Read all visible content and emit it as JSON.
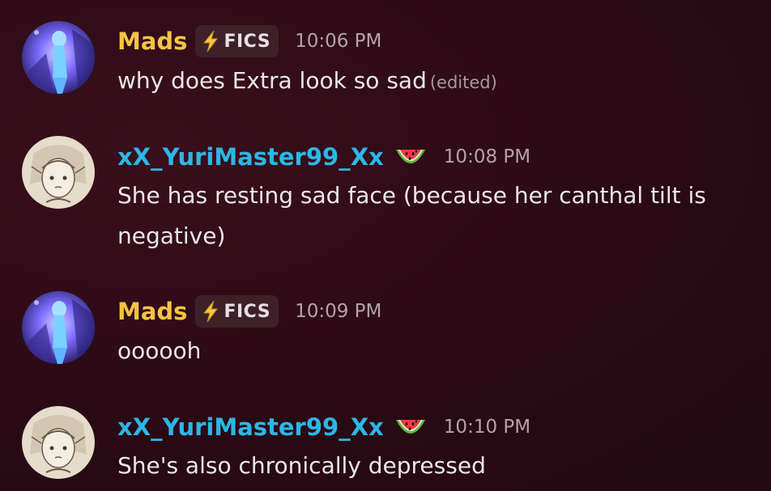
{
  "messages": [
    {
      "username": "Mads",
      "tag": "FICS",
      "tag_icon": "lightning-bolt-icon",
      "time": "10:06 PM",
      "text": "why does Extra look so sad",
      "edited": "(edited)"
    },
    {
      "username": "xX_YuriMaster99_Xx",
      "emoji": "watermelon-icon",
      "time": "10:08 PM",
      "text": "She has resting sad face (because her canthal tilt is negative)"
    },
    {
      "username": "Mads",
      "tag": "FICS",
      "tag_icon": "lightning-bolt-icon",
      "time": "10:09 PM",
      "text": "oooooh"
    },
    {
      "username": "xX_YuriMaster99_Xx",
      "emoji": "watermelon-icon",
      "time": "10:10 PM",
      "text": "She's also chronically depressed"
    }
  ],
  "colors": {
    "background": "#2a0c14",
    "mads_name": "#f4c542",
    "yuri_name": "#2cb7e6",
    "timestamp": "#b3a3a8",
    "message_text": "#eae6e7",
    "tag_background": "#3d2028"
  }
}
